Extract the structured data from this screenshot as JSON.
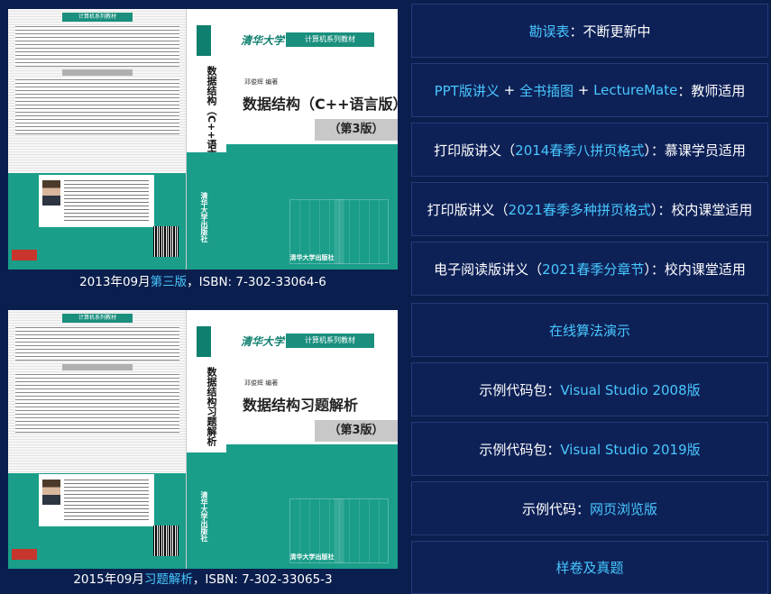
{
  "books": [
    {
      "cover": {
        "title": "数据结构（C++语言版）",
        "edition": "（第3版）",
        "spine_title": "数据结构（C++语言版）",
        "publisher": "清华大学出版社",
        "series": "计算机系列教材",
        "author": "邓俊辉 编著",
        "logo_text": "清华大学"
      },
      "caption": {
        "before": "2013年09月",
        "link": "第三版",
        "after": "，ISBN: 7-302-33064-6"
      }
    },
    {
      "cover": {
        "title": "数据结构习题解析",
        "edition": "（第3版）",
        "spine_title": "数据结构习题解析",
        "publisher": "清华大学出版社",
        "series": "计算机系列教材",
        "author": "邓俊辉 编著",
        "logo_text": "清华大学"
      },
      "caption": {
        "before": "2015年09月",
        "link": "习题解析",
        "after": "，ISBN: 7-302-33065-3"
      }
    }
  ],
  "panels": [
    {
      "link": "勘误表",
      "rest": "：不断更新中"
    },
    {
      "link1": "PPT版讲义",
      "sep1": " + ",
      "link2": "全书插图",
      "sep2": " + ",
      "link3": "LectureMate",
      "rest": "：教师适用"
    },
    {
      "before": "打印版讲义（",
      "link": "2014春季八拼页格式",
      "rest": "）：慕课学员适用"
    },
    {
      "before": "打印版讲义（",
      "link": "2021春季多种拼页格式",
      "rest": "）：校内课堂适用"
    },
    {
      "before": "电子阅读版讲义（",
      "link": "2021春季分章节",
      "rest": "）：校内课堂适用"
    },
    {
      "link": "在线算法演示"
    },
    {
      "before": "示例代码包：",
      "link": "Visual Studio 2008版"
    },
    {
      "before": "示例代码包：",
      "link": "Visual Studio 2019版"
    },
    {
      "before": "示例代码：",
      "link": "网页浏览版"
    },
    {
      "link": "样卷及真题"
    }
  ],
  "colors": {
    "background": "#0b1f4e",
    "panel": "#0e2157",
    "link": "#47c8ff",
    "cover_teal": "#1a9e8a"
  }
}
